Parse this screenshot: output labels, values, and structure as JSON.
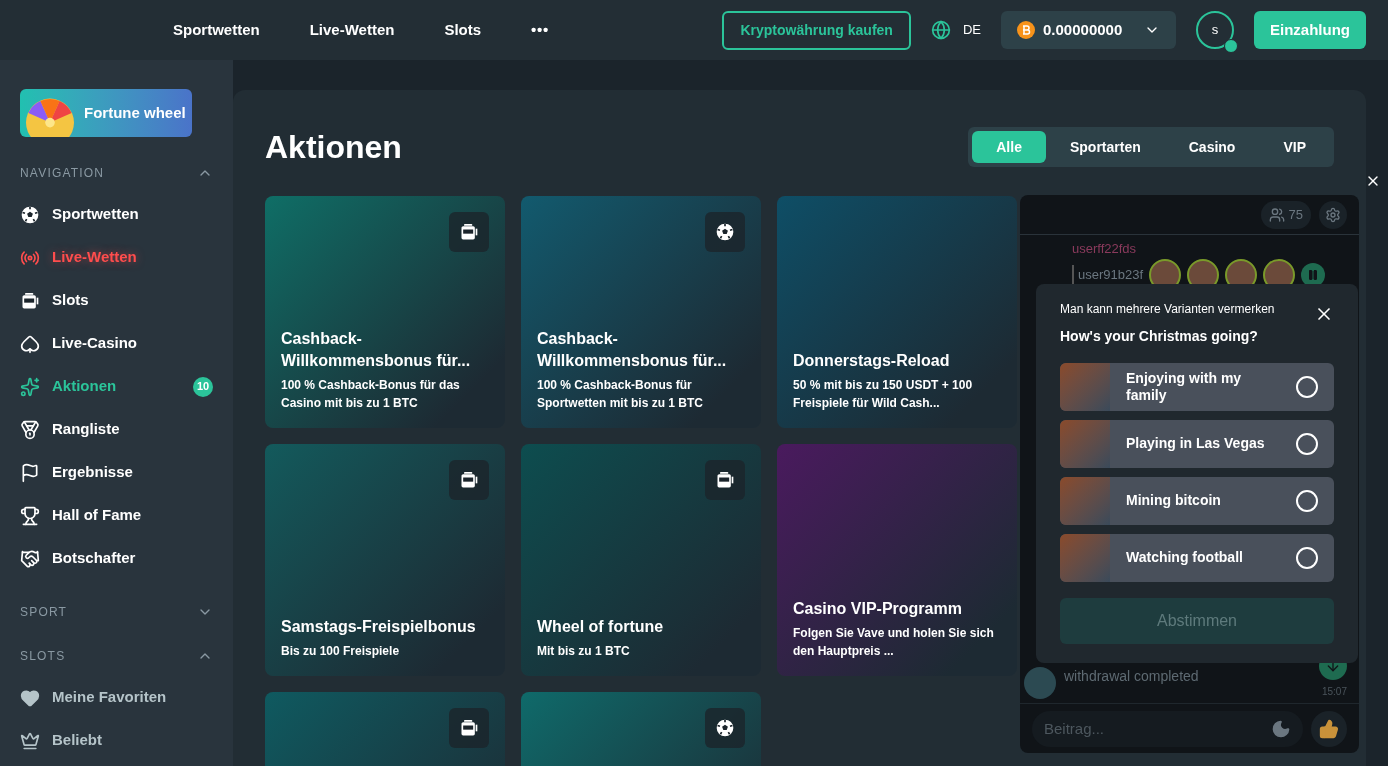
{
  "topbar": {
    "nav": [
      {
        "label": "Sportwetten"
      },
      {
        "label": "Live-Wetten"
      },
      {
        "label": "Slots"
      }
    ],
    "more": "•••",
    "buy_button": "Kryptowährung kaufen",
    "language": "DE",
    "balance": "0.00000000",
    "avatar": "s",
    "deposit_button": "Einzahlung"
  },
  "sidebar": {
    "fortune_wheel": "Fortune wheel",
    "sections": [
      {
        "title": "NAVIGATION",
        "expanded": true,
        "items": [
          {
            "label": "Sportwetten",
            "kind": "normal",
            "selected": false
          },
          {
            "label": "Live-Wetten",
            "kind": "live",
            "selected": false
          },
          {
            "label": "Slots",
            "kind": "normal",
            "selected": false
          },
          {
            "label": "Live-Casino",
            "kind": "normal",
            "selected": false
          },
          {
            "label": "Aktionen",
            "kind": "normal",
            "selected": true,
            "badge": "10"
          },
          {
            "label": "Rangliste",
            "kind": "normal",
            "selected": false
          },
          {
            "label": "Ergebnisse",
            "kind": "normal",
            "selected": false
          },
          {
            "label": "Hall of Fame",
            "kind": "normal",
            "selected": false
          },
          {
            "label": "Botschafter",
            "kind": "normal",
            "selected": false
          }
        ]
      },
      {
        "title": "SPORT",
        "expanded": false
      },
      {
        "title": "SLOTS",
        "expanded": true,
        "items": [
          {
            "label": "Meine Favoriten",
            "kind": "muted",
            "selected": false
          },
          {
            "label": "Beliebt",
            "kind": "muted",
            "selected": false
          }
        ]
      }
    ]
  },
  "page": {
    "title": "Aktionen",
    "filters": [
      {
        "label": "Alle",
        "selected": true
      },
      {
        "label": "Sportarten",
        "selected": false
      },
      {
        "label": "Casino",
        "selected": false
      },
      {
        "label": "VIP",
        "selected": false
      }
    ],
    "cards": [
      {
        "kind": "slots",
        "title": "Cashback-Willkommensbonus für...",
        "subtitle": "100 % Cashback-Bonus für das Casino mit bis zu 1 BTC",
        "color": "#0f6e66"
      },
      {
        "kind": "sport",
        "title": "Cashback-Willkommensbonus für...",
        "subtitle": "100 % Cashback-Bonus für Sportwetten mit bis zu 1 BTC",
        "color": "#125a6e"
      },
      {
        "kind": "none",
        "title": "Donnerstags-Reload",
        "subtitle": "50 % mit bis zu 150 USDT + 100 Freispiele für Wild Cash...",
        "color": "#0e4e66"
      },
      {
        "kind": "slots",
        "title": "Samstags-Freispielbonus",
        "subtitle": "Bis zu 100 Freispiele",
        "color": "#135a5c"
      },
      {
        "kind": "slots",
        "title": "Wheel of fortune",
        "subtitle": "Mit bis zu 1 BTC",
        "color": "#0d4d4f"
      },
      {
        "kind": "none",
        "title": "Casino VIP-Programm",
        "subtitle": "Folgen Sie Vave und holen Sie sich den Hauptpreis ...",
        "color": "#4a1a5e"
      },
      {
        "kind": "slots",
        "color": "#0f5a60"
      },
      {
        "kind": "sport",
        "color": "#0f6a6a"
      }
    ]
  },
  "chat": {
    "users": "75",
    "messages": [
      {
        "user": "userff22fds"
      },
      {
        "user": "user91b23f"
      }
    ],
    "last_message": "withdrawal completed",
    "time": "15:07",
    "input": {
      "placeholder": "Beitrag..."
    },
    "poll": {
      "hint": "Man kann mehrere Varianten vermerken",
      "question": "How's your Christmas going?",
      "options": [
        {
          "label": "Enjoying with my family",
          "selected": false
        },
        {
          "label": "Playing in Las Vegas",
          "selected": false
        },
        {
          "label": "Mining bitcoin",
          "selected": false
        },
        {
          "label": "Watching football",
          "selected": false
        }
      ],
      "submit": {
        "label": "Abstimmen",
        "disabled": true
      }
    }
  }
}
